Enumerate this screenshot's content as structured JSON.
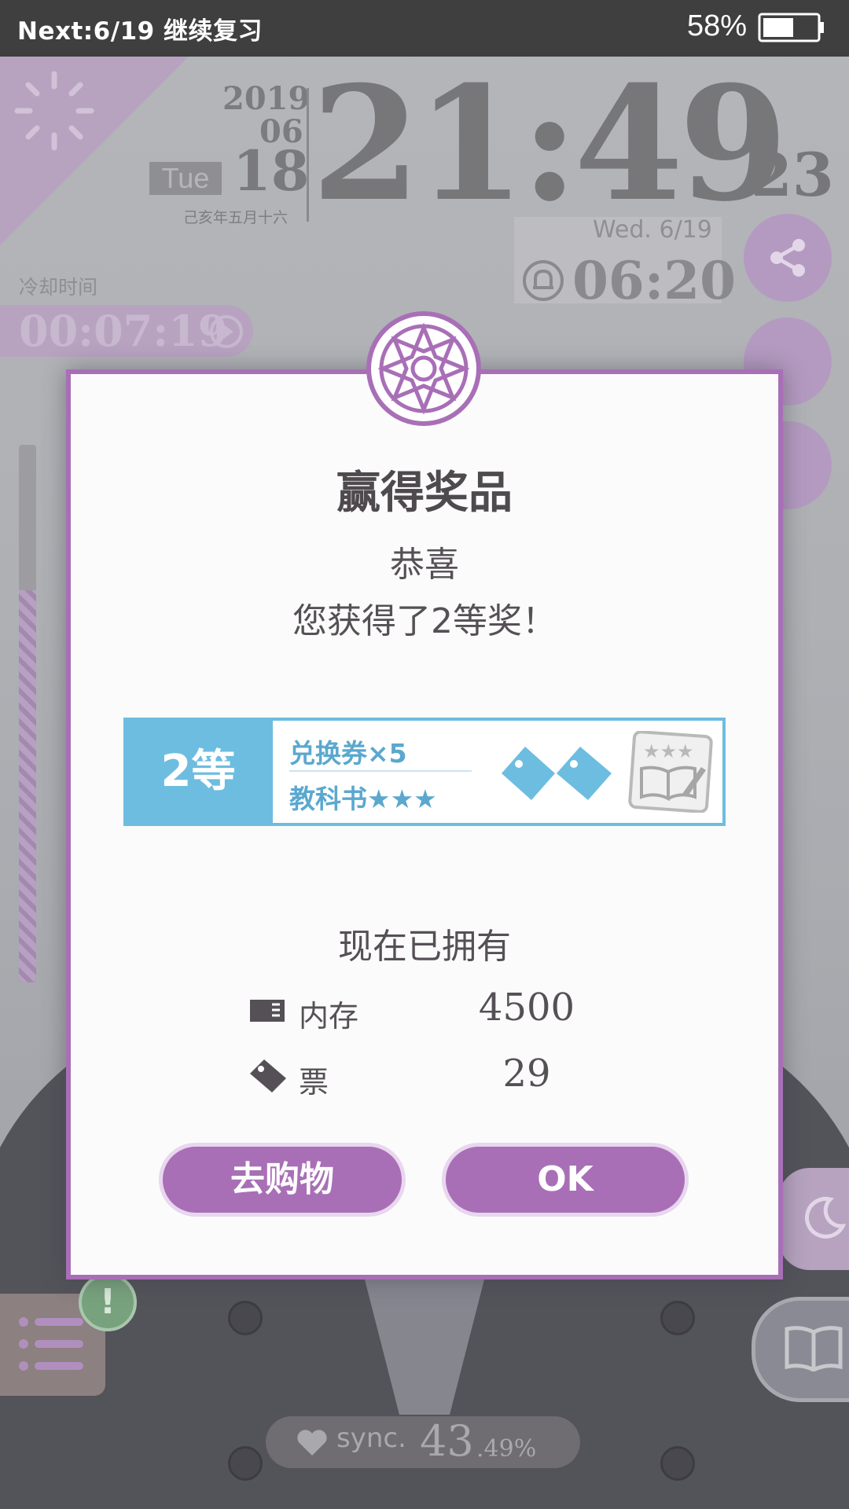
{
  "status_bar": {
    "next_text": "Next:6/19 继续复习",
    "battery_percent": "58%",
    "battery_level": 0.58
  },
  "clock": {
    "year": "2019",
    "month": "06",
    "day": "18",
    "weekday": "Tue",
    "lunar_date": "己亥年五月十六",
    "time_hm": "21:49",
    "time_seconds": "23",
    "alarm_date": "Wed.  6/19",
    "alarm_time": "06:20"
  },
  "cooldown": {
    "label": "冷却时间",
    "time": "00:07:19"
  },
  "gauge": {
    "level": 0.73
  },
  "sync": {
    "label": "sync.",
    "value_int": "43",
    "value_dec": ".49%"
  },
  "modal": {
    "title": "赢得奖品",
    "congrats": "恭喜",
    "prize_text": "您获得了2等奖！",
    "prize": {
      "rank": "2等",
      "item1": "兑换券×5",
      "item2": "教科书★★★"
    },
    "owned_title": "现在已拥有",
    "owned": [
      {
        "label": "内存",
        "value": "4500",
        "icon": "memory-card-icon"
      },
      {
        "label": "票",
        "value": "29",
        "icon": "ticket-icon"
      }
    ],
    "buttons": {
      "shop": "去购物",
      "ok": "OK"
    }
  },
  "colors": {
    "accent_purple": "#a86fb6",
    "prize_blue": "#6dbde0",
    "status_bar": "#3f3f3f"
  }
}
